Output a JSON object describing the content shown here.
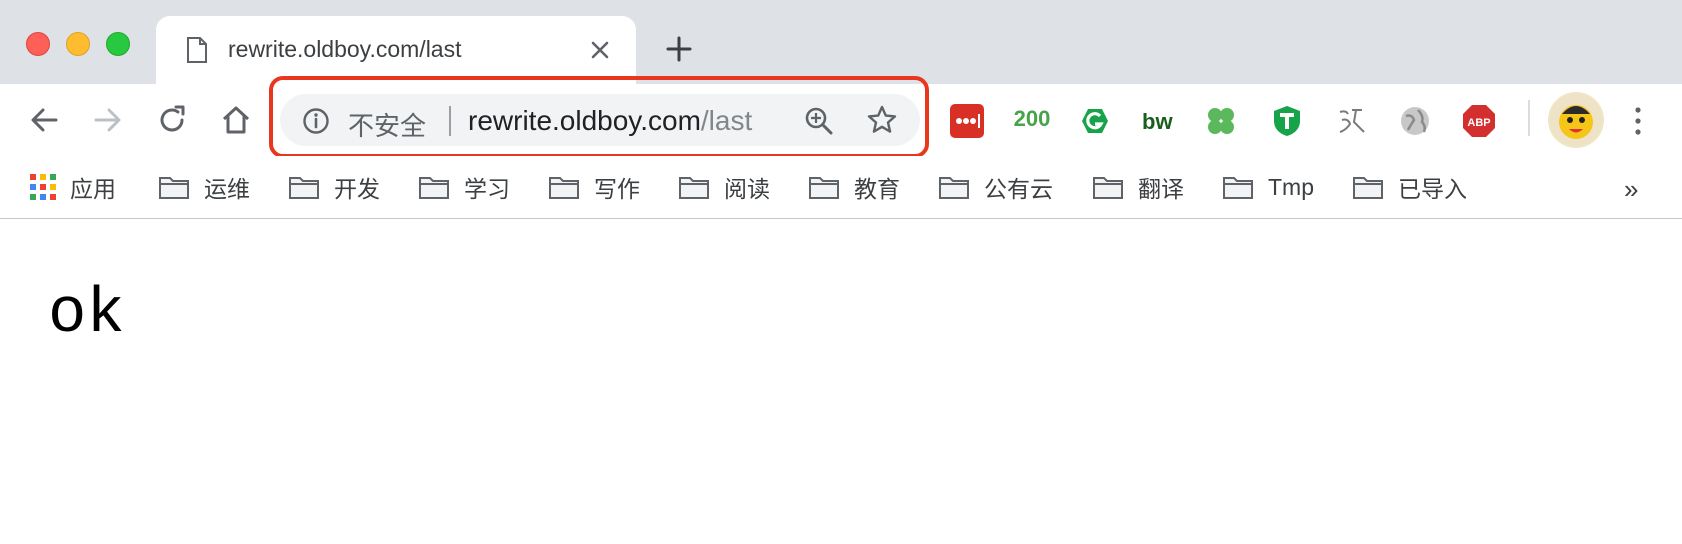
{
  "tab": {
    "title": "rewrite.oldboy.com/last"
  },
  "omnibox": {
    "security_label": "不安全",
    "url_host": "rewrite.oldboy.com",
    "url_path": "/last"
  },
  "extensions": {
    "badge_200": "200"
  },
  "bookmarks": {
    "apps_label": "应用",
    "items": [
      {
        "label": "运维"
      },
      {
        "label": "开发"
      },
      {
        "label": "学习"
      },
      {
        "label": "写作"
      },
      {
        "label": "阅读"
      },
      {
        "label": "教育"
      },
      {
        "label": "公有云"
      },
      {
        "label": "翻译"
      },
      {
        "label": "Tmp"
      },
      {
        "label": "已导入"
      }
    ],
    "more": "»"
  },
  "page": {
    "body_text": "ok"
  },
  "colors": {
    "highlight": "#e8371e",
    "tabstrip": "#dee1e6",
    "omnibox": "#f1f3f4"
  }
}
